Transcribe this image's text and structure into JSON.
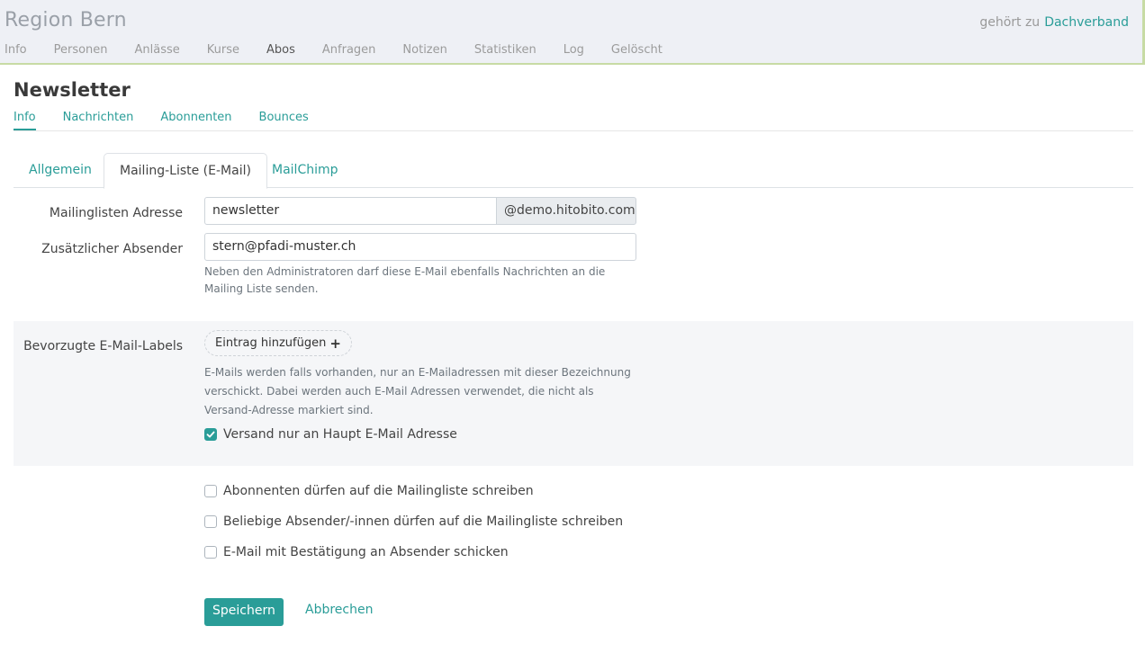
{
  "header": {
    "group_title": "Region Bern",
    "parent_prefix": "gehört zu",
    "parent_link": "Dachverband",
    "nav": [
      "Info",
      "Personen",
      "Anlässe",
      "Kurse",
      "Abos",
      "Anfragen",
      "Notizen",
      "Statistiken",
      "Log",
      "Gelöscht"
    ],
    "nav_active": "Abos"
  },
  "page": {
    "title": "Newsletter",
    "subnav": [
      "Info",
      "Nachrichten",
      "Abonnenten",
      "Bounces"
    ],
    "subnav_active": "Info"
  },
  "tabs": {
    "items": [
      "Allgemein",
      "Mailing-Liste (E-Mail)",
      "MailChimp"
    ],
    "active": "Mailing-Liste (E-Mail)"
  },
  "form": {
    "mail_address_label": "Mailinglisten Adresse",
    "mail_address_value": "newsletter",
    "mail_domain": "@demo.hitobito.com",
    "additional_sender_label": "Zusätzlicher Absender",
    "additional_sender_value": "stern@pfadi-muster.ch",
    "additional_sender_help": "Neben den Administratoren darf diese E-Mail ebenfalls Nachrichten an die Mailing Liste senden.",
    "preferred_labels_label": "Bevorzugte E-Mail-Labels",
    "add_entry": "Eintrag hinzufügen",
    "preferred_labels_help": "E-Mails werden falls vorhanden, nur an E-Mailadressen mit dieser Bezeichnung verschickt. Dabei werden auch E-Mail Adressen verwendet, die nicht als Versand-Adresse markiert sind.",
    "main_email_only": {
      "label": "Versand nur an Haupt E-Mail Adresse",
      "checked": true
    },
    "subscribers_may_post": {
      "label": "Abonnenten dürfen auf die Mailingliste schreiben",
      "checked": false
    },
    "anyone_may_post": {
      "label": "Beliebige Absender/-innen dürfen auf die Mailingliste schreiben",
      "checked": false
    },
    "delivery_report": {
      "label": "E-Mail mit Bestätigung an Absender schicken",
      "checked": false
    }
  },
  "actions": {
    "save": "Speichern",
    "cancel": "Abbrechen"
  },
  "colors": {
    "accent": "#2a9d98",
    "header_bg": "#eef0f5",
    "section_bg": "#f5f6f8"
  }
}
